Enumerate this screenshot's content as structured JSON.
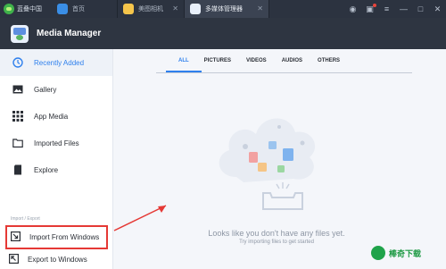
{
  "window": {
    "brand_label": "蓝叠中国",
    "tabs": [
      {
        "label": "首页"
      },
      {
        "label": "美图相机"
      },
      {
        "label": "多媒体管理器"
      }
    ]
  },
  "app": {
    "title": "Media Manager"
  },
  "sidebar": {
    "items": [
      {
        "label": "Recently Added"
      },
      {
        "label": "Gallery"
      },
      {
        "label": "App Media"
      },
      {
        "label": "Imported Files"
      },
      {
        "label": "Explore"
      }
    ],
    "group_label": "Import / Export",
    "import_items": [
      {
        "label": "Import From Windows"
      },
      {
        "label": "Export to Windows"
      }
    ]
  },
  "content": {
    "tabs": [
      {
        "label": "ALL"
      },
      {
        "label": "PICTURES"
      },
      {
        "label": "VIDEOS"
      },
      {
        "label": "AUDIOS"
      },
      {
        "label": "OTHERS"
      }
    ],
    "empty_message": "Looks like you don't have any files yet.",
    "empty_hint": "Try importing files to get started"
  },
  "watermark": {
    "text": "棒奇下载"
  },
  "colors": {
    "accent": "#2f80ed",
    "highlight": "#e53935"
  }
}
